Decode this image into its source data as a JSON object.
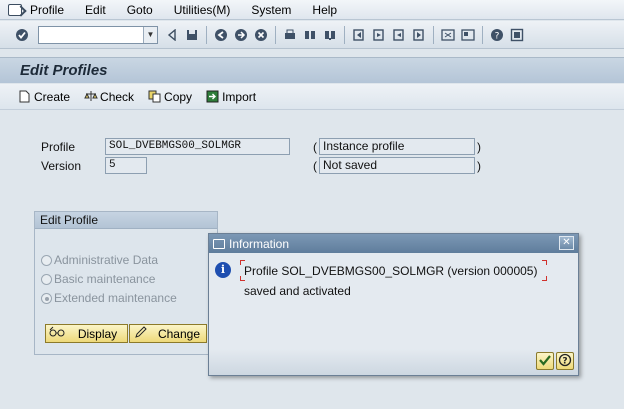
{
  "menu": {
    "items": [
      {
        "label": "Profile"
      },
      {
        "label": "Edit"
      },
      {
        "label": "Goto"
      },
      {
        "label": "Utilities(M)"
      },
      {
        "label": "System"
      },
      {
        "label": "Help"
      }
    ]
  },
  "toolbar": {
    "command_value": ""
  },
  "title": "Edit Profiles",
  "app_toolbar": {
    "create": "Create",
    "check": "Check",
    "copy": "Copy",
    "import": "Import"
  },
  "form": {
    "profile_label": "Profile",
    "profile_value": "SOL_DVEBMGS00_SOLMGR",
    "profile_desc": "Instance profile",
    "version_label": "Version",
    "version_value": "5",
    "version_desc": "Not saved",
    "paren_open": "(",
    "paren_close": ")"
  },
  "edit_group": {
    "title": "Edit Profile",
    "options": [
      {
        "label": "Administrative Data",
        "selected": false
      },
      {
        "label": "Basic maintenance",
        "selected": false
      },
      {
        "label": "Extended maintenance",
        "selected": true
      }
    ],
    "display_button": "Display",
    "change_button": "Change"
  },
  "dialog": {
    "title": "Information",
    "line1": "Profile SOL_DVEBMGS00_SOLMGR (version 000005)",
    "line2": "saved and activated"
  },
  "colors": {
    "dialog_titlebar": "#6a88a7",
    "button_yellow": "#f3e08c",
    "info_icon": "#1f4fb0"
  }
}
